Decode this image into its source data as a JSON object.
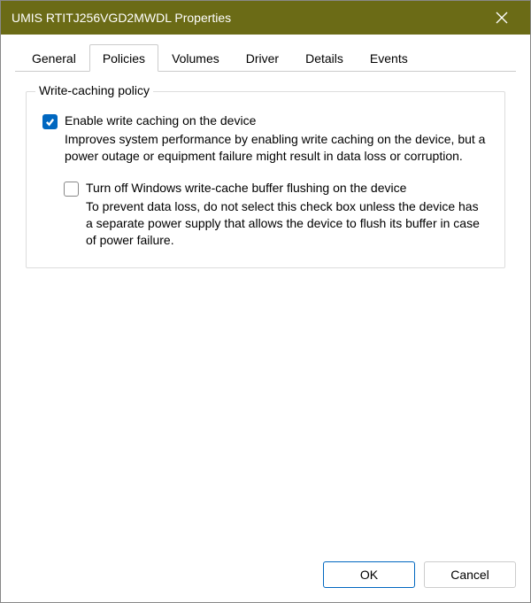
{
  "window": {
    "title": "UMIS RTITJ256VGD2MWDL Properties"
  },
  "tabs": {
    "general": "General",
    "policies": "Policies",
    "volumes": "Volumes",
    "driver": "Driver",
    "details": "Details",
    "events": "Events"
  },
  "group": {
    "legend": "Write-caching policy"
  },
  "checkbox1": {
    "label": "Enable write caching on the device",
    "desc": "Improves system performance by enabling write caching on the device, but a power outage or equipment failure might result in data loss or corruption."
  },
  "checkbox2": {
    "label": "Turn off Windows write-cache buffer flushing on the device",
    "desc": "To prevent data loss, do not select this check box unless the device has a separate power supply that allows the device to flush its buffer in case of power failure."
  },
  "buttons": {
    "ok": "OK",
    "cancel": "Cancel"
  }
}
